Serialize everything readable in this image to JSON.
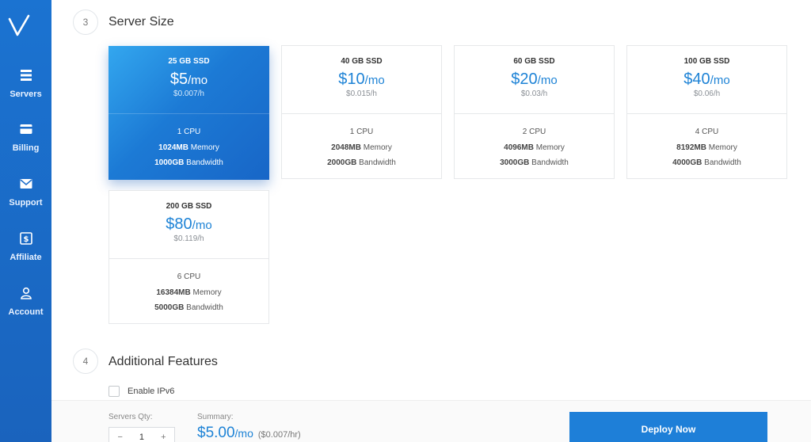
{
  "sidebar": {
    "items": [
      {
        "label": "Servers",
        "icon": "servers-icon"
      },
      {
        "label": "Billing",
        "icon": "billing-icon"
      },
      {
        "label": "Support",
        "icon": "support-icon"
      },
      {
        "label": "Affiliate",
        "icon": "affiliate-icon"
      },
      {
        "label": "Account",
        "icon": "account-icon"
      }
    ]
  },
  "server_size": {
    "step": "3",
    "title": "Server Size",
    "plans": [
      {
        "storage": "25 GB SSD",
        "price": "$5",
        "unit": "/mo",
        "hourly": "$0.007/h",
        "cpu": "1 CPU",
        "memory_val": "1024MB",
        "memory_lbl": "Memory",
        "bw_val": "1000GB",
        "bw_lbl": "Bandwidth"
      },
      {
        "storage": "40 GB SSD",
        "price": "$10",
        "unit": "/mo",
        "hourly": "$0.015/h",
        "cpu": "1 CPU",
        "memory_val": "2048MB",
        "memory_lbl": "Memory",
        "bw_val": "2000GB",
        "bw_lbl": "Bandwidth"
      },
      {
        "storage": "60 GB SSD",
        "price": "$20",
        "unit": "/mo",
        "hourly": "$0.03/h",
        "cpu": "2 CPU",
        "memory_val": "4096MB",
        "memory_lbl": "Memory",
        "bw_val": "3000GB",
        "bw_lbl": "Bandwidth"
      },
      {
        "storage": "100 GB SSD",
        "price": "$40",
        "unit": "/mo",
        "hourly": "$0.06/h",
        "cpu": "4 CPU",
        "memory_val": "8192MB",
        "memory_lbl": "Memory",
        "bw_val": "4000GB",
        "bw_lbl": "Bandwidth"
      },
      {
        "storage": "200 GB SSD",
        "price": "$80",
        "unit": "/mo",
        "hourly": "$0.119/h",
        "cpu": "6 CPU",
        "memory_val": "16384MB",
        "memory_lbl": "Memory",
        "bw_val": "5000GB",
        "bw_lbl": "Bandwidth"
      }
    ]
  },
  "features": {
    "step": "4",
    "title": "Additional Features",
    "ipv6_label": "Enable IPv6"
  },
  "bottom": {
    "qty_label": "Servers Qty:",
    "qty_minus": "−",
    "qty_value": "1",
    "qty_plus": "+",
    "summary_label": "Summary:",
    "summary_price": "$5.00",
    "summary_unit": "/mo",
    "summary_hourly": "($0.007/hr)",
    "deploy_label": "Deploy Now"
  },
  "colors": {
    "accent": "#1e83d6",
    "sidebar": "#1b6dcc",
    "deploy_button": "#1e7fd8"
  }
}
